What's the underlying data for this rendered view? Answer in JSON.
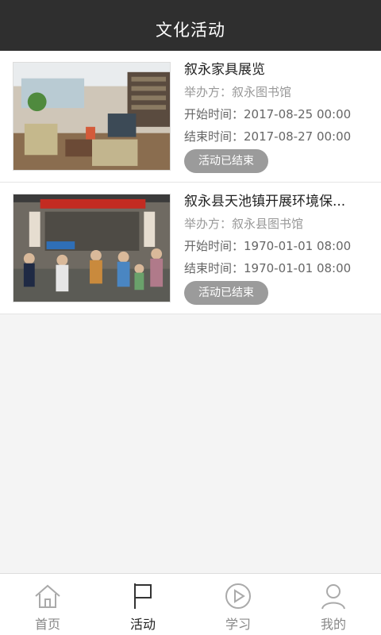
{
  "header": {
    "title": "文化活动"
  },
  "activities": [
    {
      "title": "叙永家具展览",
      "organizer": "举办方：叙永图书馆",
      "start": "开始时间：2017-08-25 00:00",
      "end": "结束时间：2017-08-27 00:00",
      "status": "活动已结束"
    },
    {
      "title": "叙永县天池镇开展环境保...",
      "organizer": "举办方：叙永县图书馆",
      "start": "开始时间：1970-01-01 08:00",
      "end": "结束时间：1970-01-01 08:00",
      "status": "活动已结束"
    }
  ],
  "tabbar": {
    "items": [
      {
        "label": "首页",
        "icon": "home-icon"
      },
      {
        "label": "活动",
        "icon": "flag-icon",
        "active": true
      },
      {
        "label": "学习",
        "icon": "play-icon"
      },
      {
        "label": "我的",
        "icon": "user-icon"
      }
    ]
  }
}
